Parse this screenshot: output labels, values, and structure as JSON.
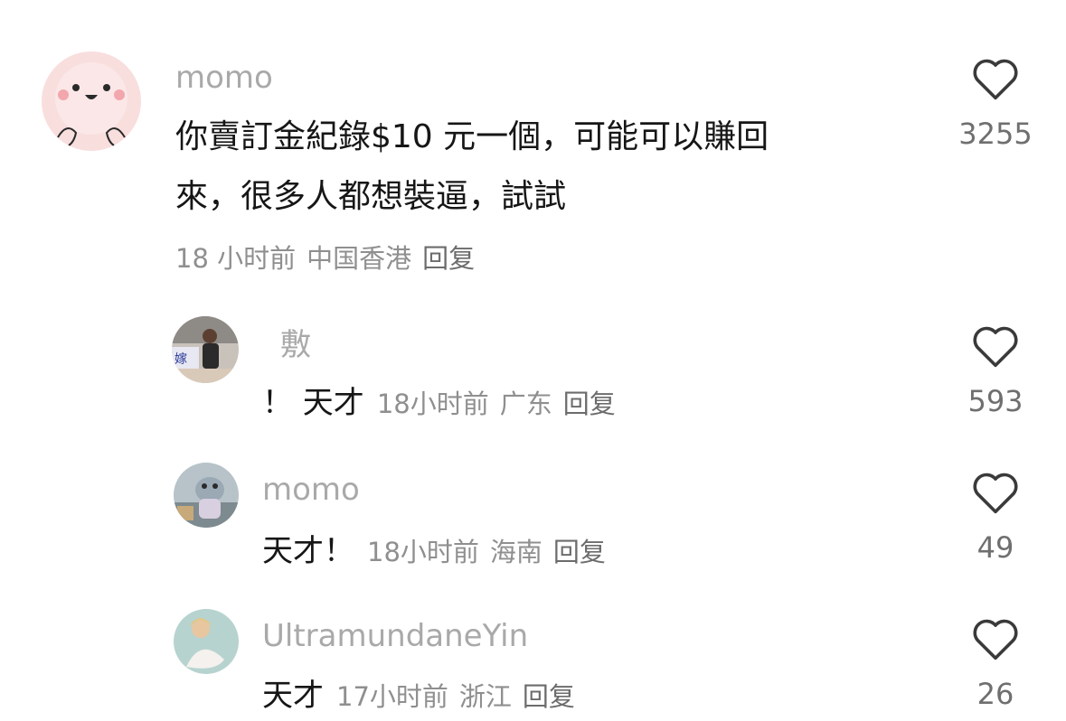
{
  "comments": [
    {
      "user": "momo",
      "text_lines": [
        "你賣訂金紀錄$10 元一個，可能可以賺回",
        "來，很多人都想裝逼，試試"
      ],
      "time": "18 小时前",
      "location": "中国香港",
      "reply": "回复",
      "likes": "3255",
      "avatar_icon": "cute-pink-character-avatar"
    }
  ],
  "replies": [
    {
      "user": "敷",
      "text": "！ 天才",
      "time": "18小时前",
      "location": "广东",
      "reply": "回复",
      "likes": "593",
      "avatar_icon": "photo-avatar-person"
    },
    {
      "user": "momo",
      "text": "天才！",
      "time": "18小时前",
      "location": "海南",
      "reply": "回复",
      "likes": "49",
      "avatar_icon": "photo-avatar-toy"
    },
    {
      "user": "UltramundaneYin",
      "text": "天才",
      "time": "17小时前",
      "location": "浙江",
      "reply": "回复",
      "likes": "26",
      "avatar_icon": "photo-avatar-woman"
    }
  ],
  "colors": {
    "username": "#a9a9a9",
    "text": "#161616",
    "meta": "#8f8f8f",
    "heart_outline": "#3a3a3a"
  }
}
